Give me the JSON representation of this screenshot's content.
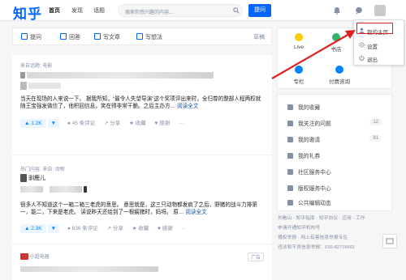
{
  "header": {
    "logo": "知乎",
    "nav": [
      "首页",
      "发现",
      "话题"
    ],
    "search_placeholder": "搜索你感兴趣的内容...",
    "ask_label": "提问"
  },
  "user_menu": {
    "items": [
      "我的主页",
      "设置",
      "退出"
    ]
  },
  "write_toolbar": {
    "items": [
      "提问",
      "回答",
      "写文章",
      "写想法"
    ],
    "draft": "草稿"
  },
  "feed": [
    {
      "source": "来自话题: 电影",
      "excerpt": "当天在现场的人来说一下。 据我所知，“最令人失望导演”这个奖项评出来时，全归尊的整部人程两权就随王宝强发微信了，他积回信息，笑在得非常干脆。之后主办方…",
      "read_more": "阅读全文",
      "votes": "1.2K",
      "comments": "45 条评论",
      "share": "分享",
      "collect": "收藏",
      "thanks": "感谢"
    },
    {
      "source": "热门内容, 来自: 动物",
      "author": "驯鹿儿",
      "excerpt": "很多人不知道这个一箱二箱三老虎的意思。 意思就是，这三只动物都发疯了之后，野猪的战斗力排第一，能二，下来是老虎。 读说昨天还给到了一根瘸猪时，妈呀。 原…",
      "read_more": "阅读全文",
      "votes": "2.3K",
      "comments": "636 条评论",
      "share": "分享",
      "collect": "收藏",
      "thanks": "感谢"
    },
    {
      "source": "小超电器",
      "ad": "广告"
    }
  ],
  "right_panel": {
    "quick": [
      "Live",
      "书店",
      "专栏",
      "付费咨询"
    ],
    "links": [
      {
        "label": "我的收藏"
      },
      {
        "label": "我关注的问题",
        "count": "12"
      },
      {
        "label": "我的邀请",
        "count": "81"
      },
      {
        "label": "我的礼券"
      },
      {
        "label": "社区服务中心"
      },
      {
        "label": "版权服务中心"
      },
      {
        "label": "公共编辑动态"
      }
    ],
    "footer": [
      "刘看山 · 知乎指南 · 知乎协议 · 应用 · 工作",
      "申请开通知乎机构号",
      "侵权举报 · 网上有害信息举报专区",
      "违法和不良信息举报：010-82716601"
    ]
  },
  "colors": {
    "brand": "#0066ff",
    "annotation": "#e02020"
  }
}
